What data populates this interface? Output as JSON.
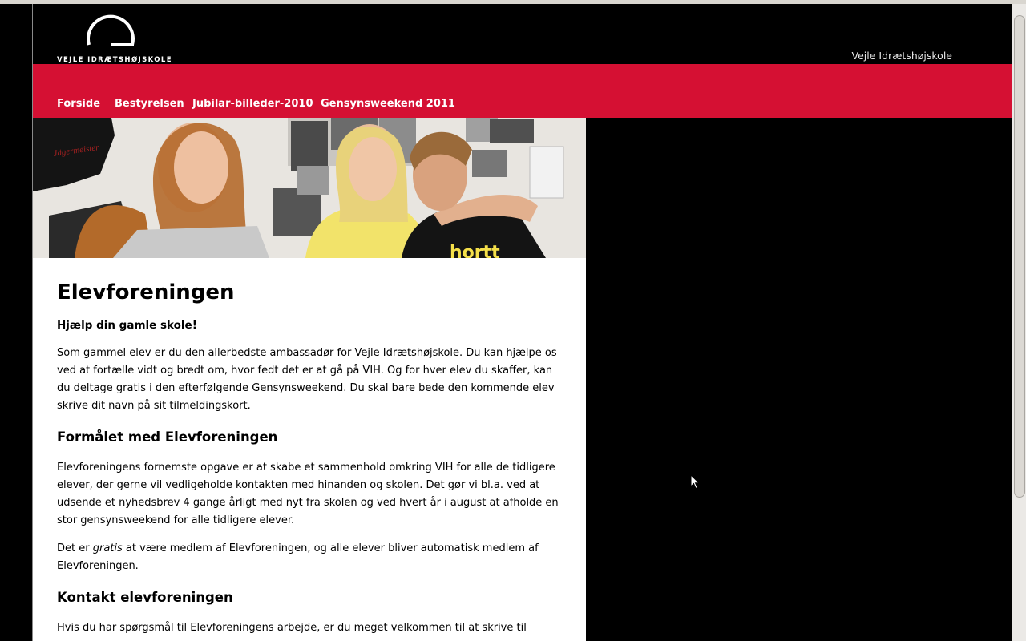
{
  "header": {
    "logo_text": "VEJLE IDRÆTSHØJSKOLE",
    "site_name": "Vejle Idrætshøjskole"
  },
  "nav": {
    "items": [
      {
        "label": "Forside"
      },
      {
        "label": "Bestyrelsen"
      },
      {
        "label": "Jubilar-billeder-2010"
      },
      {
        "label": "Gensynsweekend 2011"
      }
    ]
  },
  "hero": {
    "cap_text": "Jägermeister",
    "shirt_text": "hortt"
  },
  "article": {
    "title": "Elevforeningen",
    "intro": "Hjælp din gamle skole!",
    "p1": "Som gammel elev er du den allerbedste ambassadør for Vejle Idrætshøjskole. Du kan hjælpe os ved at fortælle vidt og bredt om, hvor fedt det er at gå på VIH. Og for hver elev du skaffer, kan du deltage gratis i den efterfølgende Gensynsweekend. Du skal bare bede den kommende elev skrive dit navn på sit tilmeldingskort.",
    "h2_purpose": "Formålet med Elevforeningen",
    "p2": "Elevforeningens fornemste opgave er at skabe et sammenhold omkring VIH for alle de tidligere elever, der gerne vil vedligeholde kontakten med hinanden og skolen. Det gør vi bl.a. ved at udsende et nyhedsbrev 4 gange årligt med nyt fra skolen og ved hvert år i august at afholde en stor gensynsweekend for alle tidligere elever.",
    "p3_before": "Det er ",
    "p3_em": "gratis",
    "p3_after": " at være medlem af Elevforeningen, og alle elever bliver automatisk medlem af Elevforeningen.",
    "h2_contact": "Kontakt elevforeningen",
    "p4": "Hvis du har spørgsmål til Elevforeningens arbejde, er du meget velkommen til at skrive til"
  },
  "colors": {
    "header_bg": "#000000",
    "nav_bg": "#d51033",
    "content_bg": "#ffffff"
  }
}
